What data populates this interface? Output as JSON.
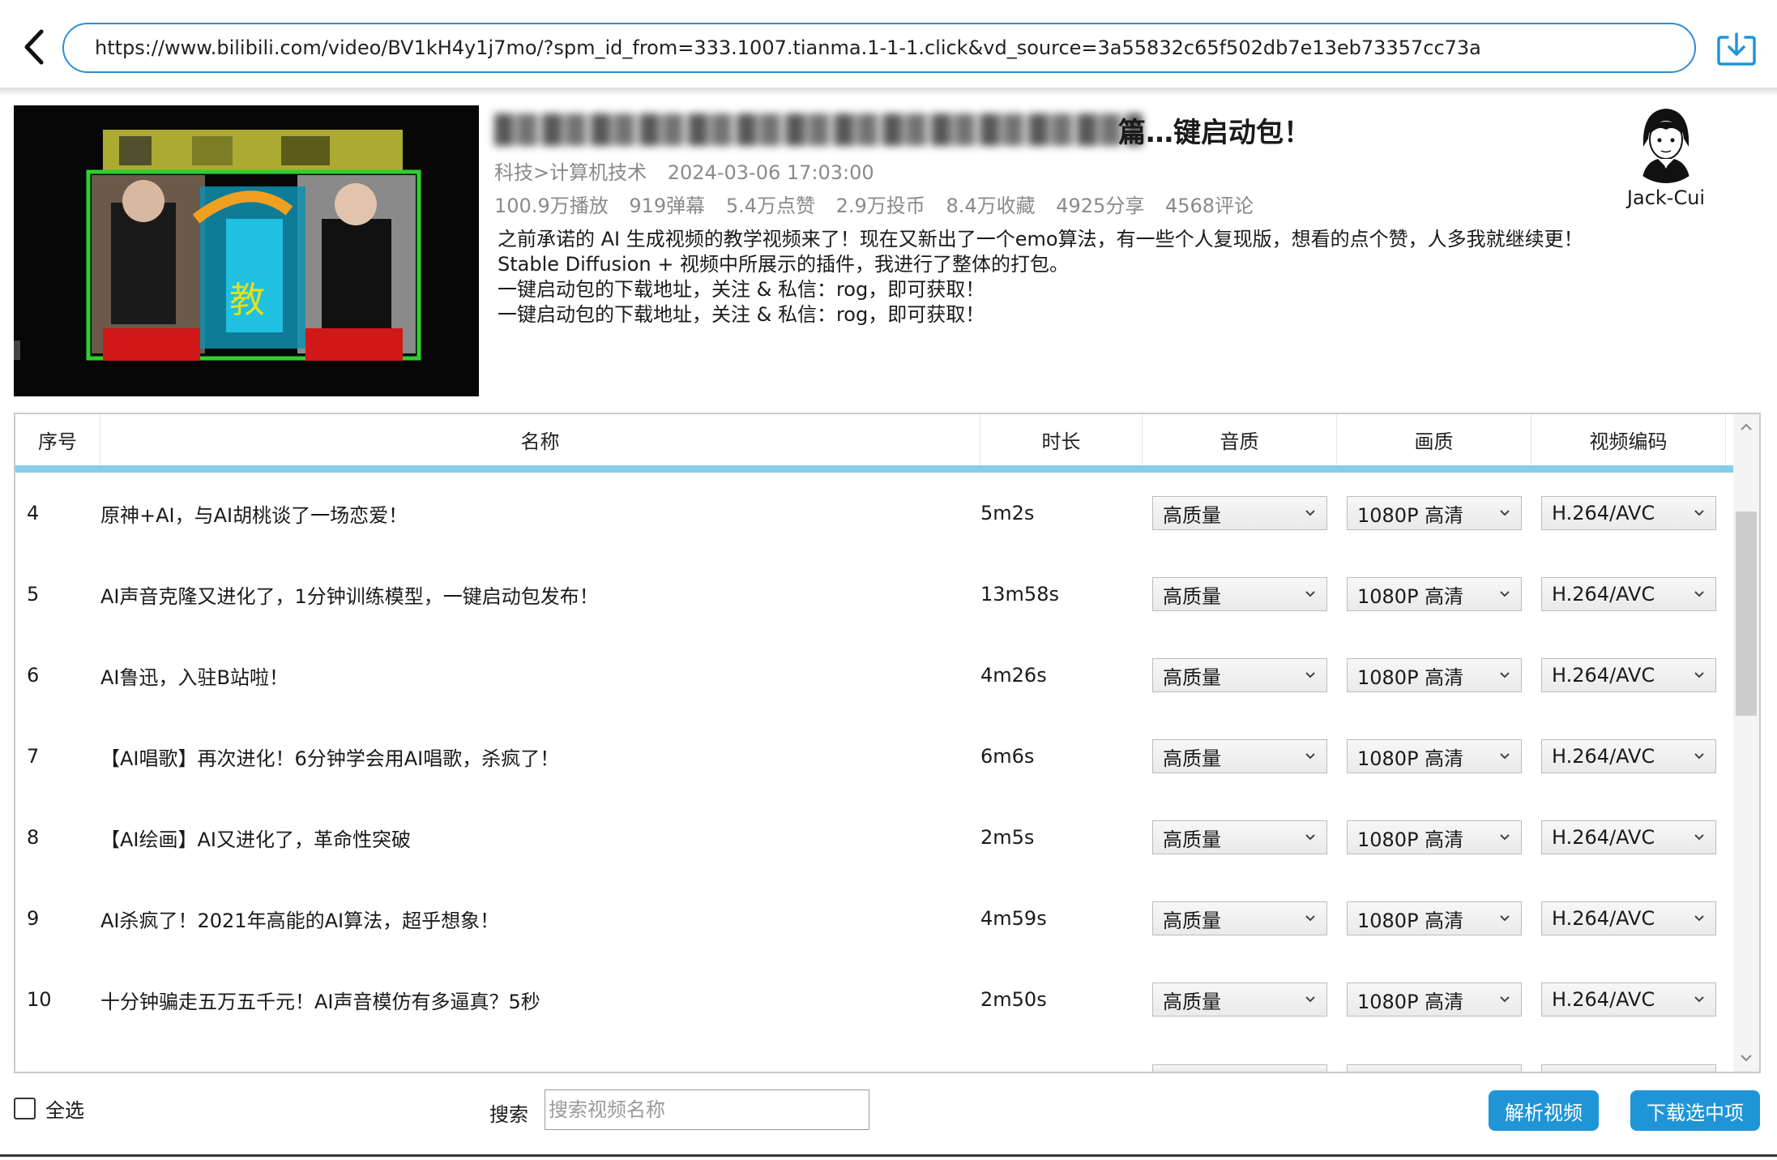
{
  "address_bar": {
    "url": "https://www.bilibili.com/video/BV1kH4y1j7mo/?spm_id_from=333.1007.tianma.1-1-1.click&vd_source=3a55832c65f502db7e13eb73357cc73a"
  },
  "video": {
    "title_visible_tail": "篇…键启动包！",
    "category": "科技>计算机技术",
    "publish_time": "2024-03-06 17:03:00",
    "stats": {
      "plays": "100.9万播放",
      "danmaku": "919弹幕",
      "likes": "5.4万点赞",
      "coins": "2.9万投币",
      "favorites": "8.4万收藏",
      "shares": "4925分享",
      "comments": "4568评论"
    },
    "description": [
      "之前承诺的 AI 生成视频的教学视频来了！现在又新出了一个emo算法，有一些个人复现版，想看的点个赞，人多我就继续更！",
      "Stable Diffusion + 视频中所展示的插件，我进行了整体的打包。",
      "一键启动包的下载地址，关注 & 私信：rog，即可获取！",
      "一键启动包的下载地址，关注 & 私信：rog，即可获取！"
    ],
    "thumbnail_text": "教"
  },
  "author": {
    "name": "Jack-Cui"
  },
  "table": {
    "headers": [
      "序号",
      "名称",
      "时长",
      "音质",
      "画质",
      "视频编码"
    ],
    "rows": [
      {
        "idx": "4",
        "name": "原神+AI，与AI胡桃谈了一场恋爱！",
        "duration": "5m2s",
        "audio": "高质量",
        "quality": "1080P 高清",
        "codec": "H.264/AVC"
      },
      {
        "idx": "5",
        "name": "AI声音克隆又进化了，1分钟训练模型，一键启动包发布！",
        "duration": "13m58s",
        "audio": "高质量",
        "quality": "1080P 高清",
        "codec": "H.264/AVC"
      },
      {
        "idx": "6",
        "name": "AI鲁迅，入驻B站啦！",
        "duration": "4m26s",
        "audio": "高质量",
        "quality": "1080P 高清",
        "codec": "H.264/AVC"
      },
      {
        "idx": "7",
        "name": "【AI唱歌】再次进化！6分钟学会用AI唱歌，杀疯了！",
        "duration": "6m6s",
        "audio": "高质量",
        "quality": "1080P 高清",
        "codec": "H.264/AVC"
      },
      {
        "idx": "8",
        "name": "【AI绘画】AI又进化了，革命性突破",
        "duration": "2m5s",
        "audio": "高质量",
        "quality": "1080P 高清",
        "codec": "H.264/AVC"
      },
      {
        "idx": "9",
        "name": "AI杀疯了！2021年高能的AI算法，超乎想象！",
        "duration": "4m59s",
        "audio": "高质量",
        "quality": "1080P 高清",
        "codec": "H.264/AVC"
      },
      {
        "idx": "10",
        "name": "十分钟骗走五万五千元！AI声音模仿有多逼真？5秒",
        "duration": "2m50s",
        "audio": "高质量",
        "quality": "1080P 高清",
        "codec": "H.264/AVC"
      }
    ]
  },
  "footer": {
    "select_all_label": "全选",
    "search_label": "搜索",
    "search_placeholder": "搜索视频名称",
    "search_value": "",
    "parse_button": "解析视频",
    "download_button": "下载选中项"
  },
  "colors": {
    "accent": "#1f95d8",
    "url_border": "#2f8cd6",
    "header_underline": "#87cdea",
    "meta_text": "#8a8a8a"
  },
  "icons": {
    "back": "chevron-left-icon",
    "download": "download-tray-icon",
    "dropdown": "chevron-down-icon",
    "scroll_up": "chevron-up-icon",
    "scroll_down": "chevron-down-icon"
  }
}
